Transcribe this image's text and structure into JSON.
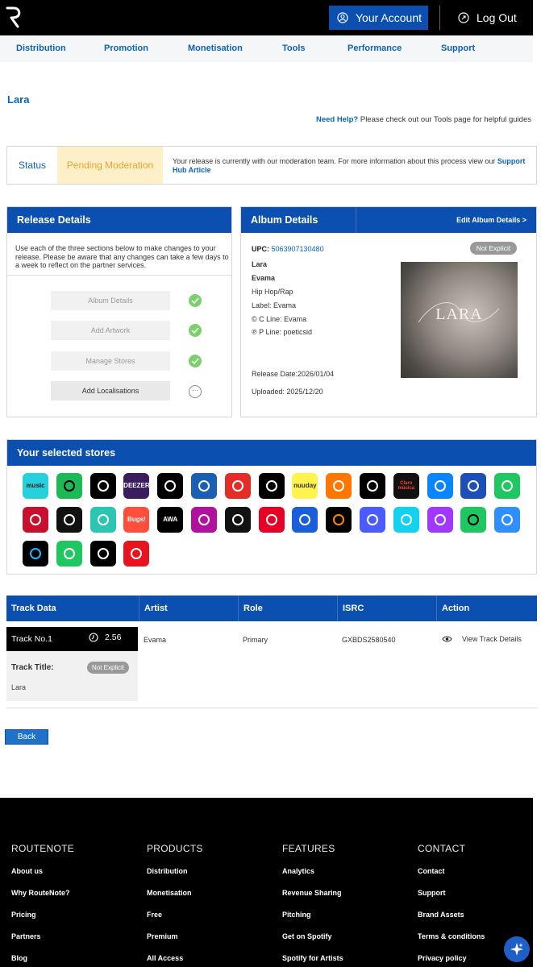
{
  "header": {
    "account_label": "Your Account",
    "logout_label": "Log Out"
  },
  "nav": {
    "items": [
      "Distribution",
      "Promotion",
      "Monetisation",
      "Tools",
      "Performance",
      "Support"
    ]
  },
  "release": {
    "artist_title": "Lara",
    "help_bold": "Need Help?",
    "help_text": " Please check out our Tools page for helpful guides"
  },
  "status": {
    "label": "Status",
    "value": "Pending Moderation",
    "message": "Your release is currently with our moderation team. For more information about this process view our ",
    "link": "Support Hub Article"
  },
  "release_details": {
    "title": "Release Details",
    "description": "Use each of the three sections below to make changes to your release. Please be aware that any changes can take a few days to a week to reflect on the partner services.",
    "steps": [
      "Album Details",
      "Add Artwork",
      "Manage Stores",
      "Add Localisations"
    ],
    "pending_mark": "···"
  },
  "album_details": {
    "title": "Album Details",
    "edit_link": "Edit Album Details  >",
    "upc_label": "UPC: ",
    "upc_value": "5063907130480",
    "explicit_badge": "Not Explicit",
    "album_title": "Lara",
    "artist": "Evama",
    "genre": "Hip Hop/Rap",
    "label": "Label: Evama",
    "c_line": "© C Line: Evama",
    "p_line": "℗ P Line: poeticsid",
    "release_date": "Release Date:2026/01/04",
    "uploaded": "Uploaded: 2025/12/20",
    "cover_text": "LARA"
  },
  "stores": {
    "title": "Your selected stores",
    "icons": [
      {
        "name": "amazon-music-icon",
        "label": "music",
        "bg": "#25d1da",
        "fg": "#1a1a1a"
      },
      {
        "name": "spotify-icon",
        "label": "",
        "bg": "#1db954",
        "fg": "#000"
      },
      {
        "name": "apple-music-icon",
        "label": "",
        "bg": "#000000",
        "fg": "#fff"
      },
      {
        "name": "deezer-icon",
        "label": "DEEZER",
        "bg": "#3b1c5e",
        "fg": "#fff"
      },
      {
        "name": "napster-icon",
        "label": "",
        "bg": "#000000",
        "fg": "#fff"
      },
      {
        "name": "routenote-icon",
        "label": "",
        "bg": "#1a5fb4",
        "fg": "#fff"
      },
      {
        "name": "youtube-music-icon",
        "label": "",
        "bg": "#e52d27",
        "fg": "#fff"
      },
      {
        "name": "tidal-icon",
        "label": "",
        "bg": "#000000",
        "fg": "#fff"
      },
      {
        "name": "nuuday-icon",
        "label": "nuuday",
        "bg": "#fff34d",
        "fg": "#333"
      },
      {
        "name": "soundcloud-icon",
        "label": "",
        "bg": "#ff7700",
        "fg": "#fff"
      },
      {
        "name": "qobuz-icon",
        "label": "",
        "bg": "#000000",
        "fg": "#fff"
      },
      {
        "name": "claro-musica-icon",
        "label": "Claro música",
        "bg": "#111111",
        "fg": "#ff3b30"
      },
      {
        "name": "kkbox-icon",
        "label": "",
        "bg": "#0a84ff",
        "fg": "#fff"
      },
      {
        "name": "pandora-icon",
        "label": "",
        "bg": "#1c4fb8",
        "fg": "#fff"
      },
      {
        "name": "boomplay-icon",
        "label": "",
        "bg": "#1ec760",
        "fg": "#fff"
      },
      {
        "name": "iheartradio-icon",
        "label": "",
        "bg": "#c8102e",
        "fg": "#fff"
      },
      {
        "name": "audiomack-icon",
        "label": "",
        "bg": "#111111",
        "fg": "#fff"
      },
      {
        "name": "jiosaavn-icon",
        "label": "",
        "bg": "#2bc5b4",
        "fg": "#fff"
      },
      {
        "name": "bugs-icon",
        "label": "Bugs!",
        "bg": "#ff4e3c",
        "fg": "#fff"
      },
      {
        "name": "awa-icon",
        "label": "AWA",
        "bg": "#000000",
        "fg": "#fff"
      },
      {
        "name": "anghami-icon",
        "label": "",
        "bg": "#b0129d",
        "fg": "#fff"
      },
      {
        "name": "shazam-icon",
        "label": "",
        "bg": "#111111",
        "fg": "#fff"
      },
      {
        "name": "netease-icon",
        "label": "",
        "bg": "#e60026",
        "fg": "#fff"
      },
      {
        "name": "tencent-icon",
        "label": "",
        "bg": "#1a5fd9",
        "fg": "#fff"
      },
      {
        "name": "kugou-icon",
        "label": "",
        "bg": "#000000",
        "fg": "#ff8a00"
      },
      {
        "name": "flo-icon",
        "label": "",
        "bg": "#4a5cff",
        "fg": "#fff"
      },
      {
        "name": "kuack-icon",
        "label": "",
        "bg": "#12d2f0",
        "fg": "#fff"
      },
      {
        "name": "melon-icon",
        "label": "",
        "bg": "#a238ff",
        "fg": "#fff"
      },
      {
        "name": "vibe-icon",
        "label": "",
        "bg": "#1ec760",
        "fg": "#000"
      },
      {
        "name": "genie-icon",
        "label": "",
        "bg": "#2f8fff",
        "fg": "#fff"
      },
      {
        "name": "beatport-icon",
        "label": "",
        "bg": "#000000",
        "fg": "#2ab3ff"
      },
      {
        "name": "music-note-icon",
        "label": "",
        "bg": "#1ec760",
        "fg": "#fff"
      },
      {
        "name": "capcut-icon",
        "label": "",
        "bg": "#000000",
        "fg": "#fff"
      },
      {
        "name": "fanzone-icon",
        "label": "",
        "bg": "#e8131d",
        "fg": "#fff"
      }
    ]
  },
  "tracks": {
    "headers": [
      "Track Data",
      "Artist",
      "Role",
      "ISRC",
      "Action"
    ],
    "track_no": "Track No.1",
    "duration": "2.56",
    "title_label": "Track Title:",
    "explicit_badge": "Not Explicit",
    "title_value": "Lara",
    "artist": "Evama",
    "role": "Primary",
    "isrc": "GXBDS2580540",
    "action": "View Track Details"
  },
  "back_label": "Back",
  "footer": {
    "columns": [
      {
        "title": "ROUTENOTE",
        "links": [
          "About us",
          "Why RouteNote?",
          "Pricing",
          "Partners",
          "Blog"
        ]
      },
      {
        "title": "PRODUCTS",
        "links": [
          "Distribution",
          "Monetisation",
          "Free",
          "Premium",
          "All Access"
        ]
      },
      {
        "title": "FEATURES",
        "links": [
          "Analytics",
          "Revenue Sharing",
          "Pitching",
          "Get on Spotify",
          "Spotify for Artists"
        ]
      },
      {
        "title": "CONTACT",
        "links": [
          "Contact",
          "Support",
          "Brand Assets",
          "Terms & conditions",
          "Privacy policy"
        ]
      }
    ]
  }
}
